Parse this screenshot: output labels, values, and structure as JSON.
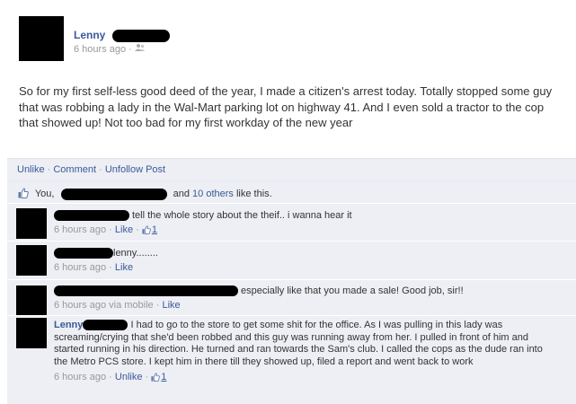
{
  "post": {
    "author": "Lenny",
    "timestamp": "6 hours ago",
    "separator": "·",
    "audience_icon": "friends-icon",
    "text": "So for my first self-less good deed of the year, I made a citizen's arrest today. Totally stopped some guy that was robbing a lady in the Wal-Mart parking lot on highway 41. And I even sold a tractor to the cop that showed up! Not too bad for my first workday of the new year"
  },
  "actions": {
    "unlike": "Unlike",
    "comment": "Comment",
    "unfollow": "Unfollow Post",
    "sep": " · "
  },
  "likes": {
    "icon": "thumbs-up-icon",
    "you": "You,",
    "and": "and",
    "others": "10 others",
    "suffix": "like this."
  },
  "comments": [
    {
      "text": "tell the whole story about the theif.. i wanna hear it",
      "time": "6 hours ago",
      "action": "Like",
      "like_count": "1"
    },
    {
      "text": "lenny........",
      "time": "6 hours ago",
      "action": "Like"
    },
    {
      "text": "especially like that you made a sale! Good job, sir!!",
      "time": "6 hours ago via mobile",
      "action": "Like"
    },
    {
      "name": "Lenny",
      "text": "I had to go to the store to get some shit for the office. As I was pulling in this lady was screaming/crying that she'd been robbed and this guy was running away from her. I pulled in front of him and started running in his direction. He turned and ran towards the Sam's club. I called the cops as the dude ran into the Metro PCS store. I kept him in there till they showed up, filed a report and went back to work",
      "time": "6 hours ago",
      "action": "Unlike",
      "like_count": "1"
    }
  ],
  "colors": {
    "link": "#3b5998",
    "ufi_bg": "#edeff4",
    "meta": "#999999"
  }
}
